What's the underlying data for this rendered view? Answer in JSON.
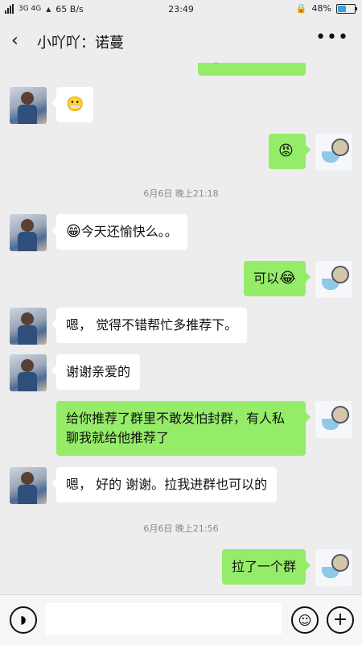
{
  "status_bar": {
    "signal_label": "3G 4G",
    "speed": "65 B/s",
    "time": "23:49",
    "battery": "48%",
    "battery_level": 0.48
  },
  "header": {
    "back_icon": "chevron-left-icon",
    "title": "小吖吖：诺蔓",
    "more_icon": "more-dots-icon"
  },
  "messages": [
    {
      "side": "right",
      "text": "",
      "emoji": "😂"
    },
    {
      "side": "left",
      "text": "",
      "emoji": "😬"
    },
    {
      "side": "right",
      "text": "",
      "emoji": "😡"
    },
    {
      "type": "time",
      "text": "6月6日  晚上21:18"
    },
    {
      "side": "left",
      "text": "今天还愉快么。。",
      "emoji": "😁"
    },
    {
      "side": "right",
      "text": "可以",
      "emoji": "😂"
    },
    {
      "side": "left",
      "text": "嗯， 觉得不错帮忙多推荐下。"
    },
    {
      "side": "left",
      "text": "谢谢亲爱的"
    },
    {
      "side": "right",
      "text": "给你推荐了群里不敢发怕封群，有人私聊我就给他推荐了"
    },
    {
      "side": "left",
      "text": "嗯， 好的 谢谢。拉我进群也可以的"
    },
    {
      "type": "time",
      "text": "6月6日  晚上21:56"
    },
    {
      "side": "right",
      "text": "拉了一个群"
    }
  ],
  "input_bar": {
    "voice_icon": "voice-icon",
    "emoji_icon": "emoji-smile-icon",
    "plus_icon": "plus-icon"
  }
}
